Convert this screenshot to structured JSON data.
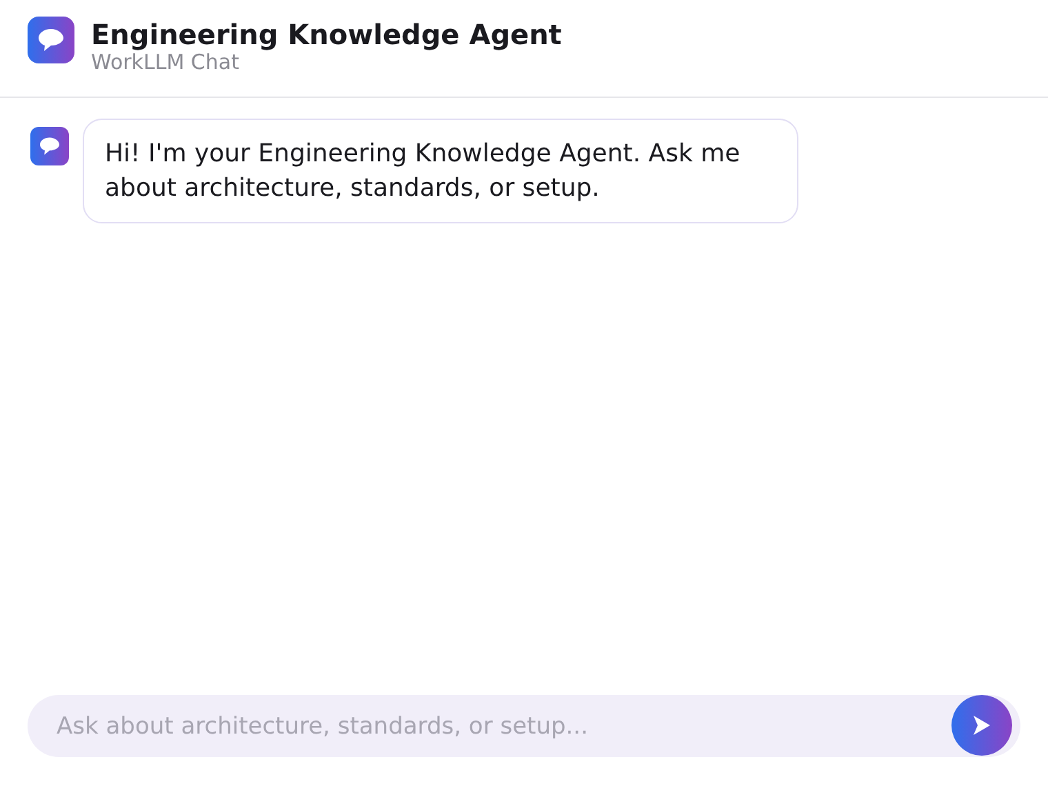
{
  "header": {
    "title": "Engineering Knowledge Agent",
    "subtitle": "WorkLLM Chat"
  },
  "messages": [
    {
      "kind": "agent",
      "text": "Hi! I'm your Engineering Knowledge Agent. Ask me about architecture, standards, or setup."
    }
  ],
  "composer": {
    "placeholder": "Ask about architecture, standards, or setup..."
  }
}
